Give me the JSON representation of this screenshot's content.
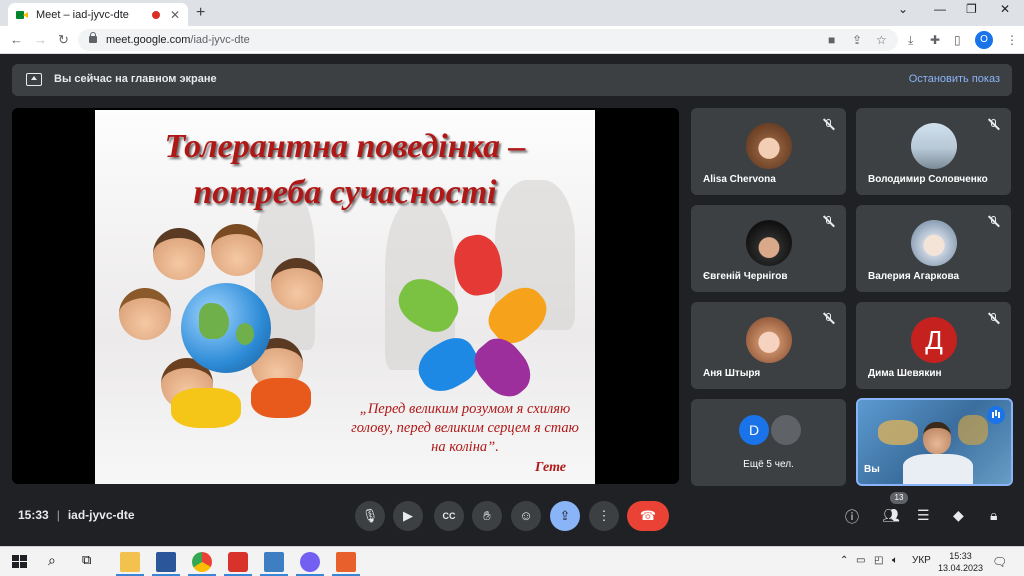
{
  "browser": {
    "tab_title": "Meet – iad-jyvc-dte",
    "new_tab": "+",
    "url_host": "meet.google.com",
    "url_path": "/iad-jyvc-dte",
    "profile_initial": "O"
  },
  "banner": {
    "text": "Вы сейчас на главном экране",
    "stop_label": "Остановить показ"
  },
  "slide": {
    "title_line1": "Толерантна поведінка –",
    "title_line2": "потреба сучасності",
    "quote": "„Перед великим розумом я схиляю голову, перед великим серцем я стаю на коліна”.",
    "author": "Гете"
  },
  "participants": [
    {
      "name": "Alisa Chervona"
    },
    {
      "name": "Володимир Соловченко"
    },
    {
      "name": "Євгеній Чернігов"
    },
    {
      "name": "Валерия Агаркова"
    },
    {
      "name": "Аня Штыря"
    },
    {
      "name": "Дима Шевякин",
      "initial": "Д"
    }
  ],
  "more": {
    "initial": "D",
    "label": "Ещё 5 чел."
  },
  "self_view": {
    "name_partial": "Вы"
  },
  "meeting": {
    "time": "15:33",
    "separator": "|",
    "code": "iad-jyvc-dte"
  },
  "people_count": "13",
  "taskbar": {
    "lang": "УКР",
    "time": "15:33",
    "date": "13.04.2023"
  },
  "colors": {
    "accent": "#8ab4f8",
    "end_call": "#ea4335",
    "slide_title": "#b01818",
    "avatar_d": "#c5221f"
  }
}
